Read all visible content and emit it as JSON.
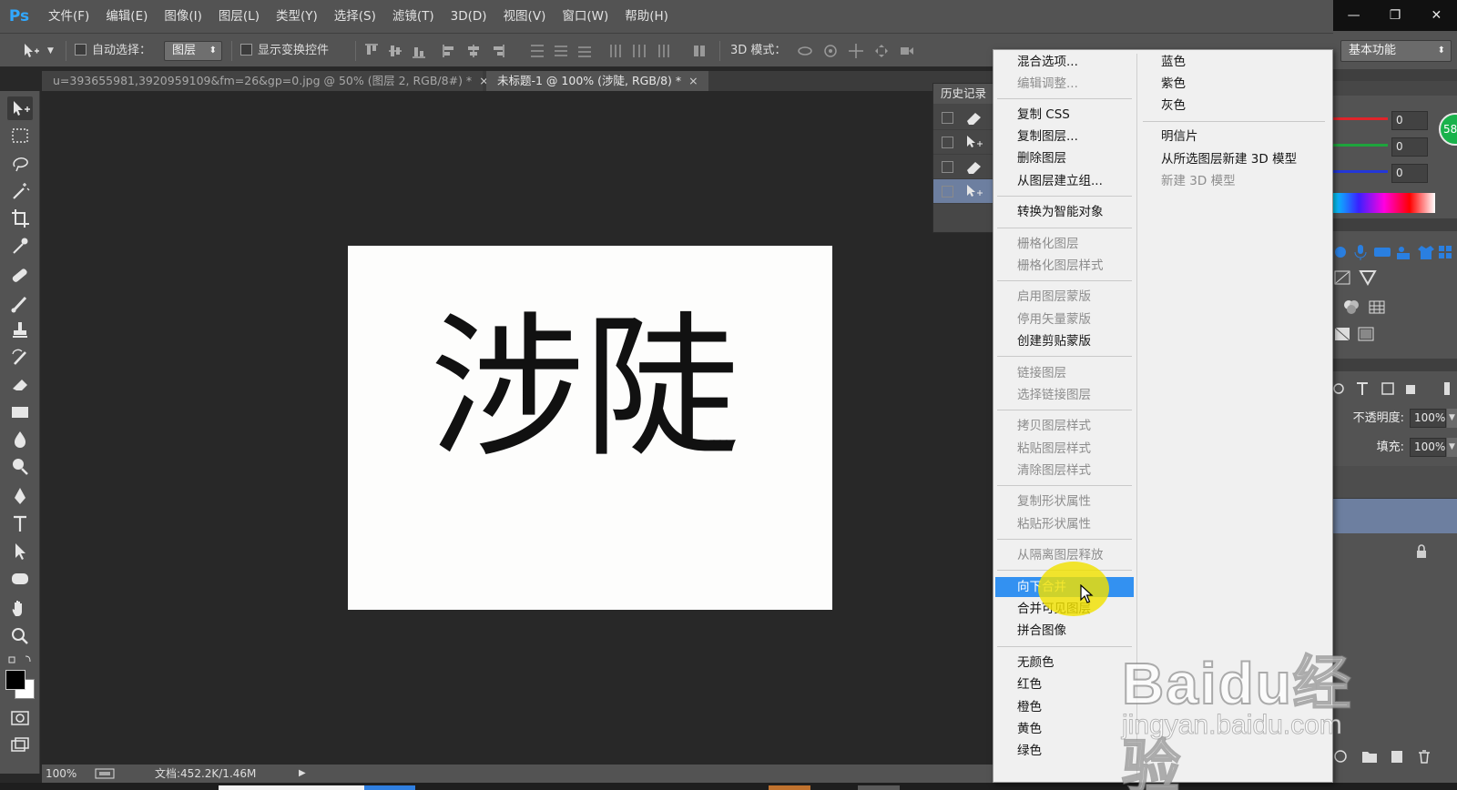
{
  "app": {
    "logo": "Ps",
    "menus": [
      "文件(F)",
      "编辑(E)",
      "图像(I)",
      "图层(L)",
      "类型(Y)",
      "选择(S)",
      "滤镜(T)",
      "3D(D)",
      "视图(V)",
      "窗口(W)",
      "帮助(H)"
    ],
    "window_controls": [
      "—",
      "❐",
      "✕"
    ]
  },
  "options": {
    "auto_select_label": "自动选择：",
    "auto_select_value": "图层",
    "show_transform_label": "显示变换控件",
    "mode_3d_label": "3D 模式："
  },
  "tabs": [
    {
      "label": "u=393655981,3920959109&fm=26&gp=0.jpg @ 50% (图层 2, RGB/8#) *",
      "close": "×"
    },
    {
      "label": "未标题-1 @ 100% (涉陡, RGB/8) *",
      "close": "×"
    }
  ],
  "canvas": {
    "glyph": "涉陡"
  },
  "status": {
    "zoom": "100%",
    "doc_info": "文档:452.2K/1.46M",
    "arrow": "▶"
  },
  "history": {
    "title": "历史记录"
  },
  "context_menu": {
    "col1": [
      {
        "label": "混合选项...",
        "enabled": true
      },
      {
        "label": "编辑调整...",
        "enabled": false
      },
      {
        "label": "复制 CSS",
        "enabled": true
      },
      {
        "label": "复制图层...",
        "enabled": true
      },
      {
        "label": "删除图层",
        "enabled": true
      },
      {
        "label": "从图层建立组...",
        "enabled": true
      },
      {
        "label": "转换为智能对象",
        "enabled": true
      },
      {
        "label": "栅格化图层",
        "enabled": false
      },
      {
        "label": "栅格化图层样式",
        "enabled": false
      },
      {
        "label": "启用图层蒙版",
        "enabled": false
      },
      {
        "label": "停用矢量蒙版",
        "enabled": false
      },
      {
        "label": "创建剪贴蒙版",
        "enabled": true
      },
      {
        "label": "链接图层",
        "enabled": false
      },
      {
        "label": "选择链接图层",
        "enabled": false
      },
      {
        "label": "拷贝图层样式",
        "enabled": false
      },
      {
        "label": "粘贴图层样式",
        "enabled": false
      },
      {
        "label": "清除图层样式",
        "enabled": false
      },
      {
        "label": "复制形状属性",
        "enabled": false
      },
      {
        "label": "粘贴形状属性",
        "enabled": false
      },
      {
        "label": "从隔离图层释放",
        "enabled": false
      },
      {
        "label": "向下合并",
        "enabled": true,
        "highlighted": true
      },
      {
        "label": "合并可见图层",
        "enabled": true
      },
      {
        "label": "拼合图像",
        "enabled": true
      },
      {
        "label": "无颜色",
        "enabled": true
      },
      {
        "label": "红色",
        "enabled": true
      },
      {
        "label": "橙色",
        "enabled": true
      },
      {
        "label": "黄色",
        "enabled": true
      },
      {
        "label": "绿色",
        "enabled": true
      }
    ],
    "col2": [
      {
        "label": "蓝色",
        "enabled": true
      },
      {
        "label": "紫色",
        "enabled": true
      },
      {
        "label": "灰色",
        "enabled": true
      },
      {
        "label": "明信片",
        "enabled": true
      },
      {
        "label": "从所选图层新建 3D 模型",
        "enabled": true
      },
      {
        "label": "新建 3D 模型",
        "enabled": false
      }
    ]
  },
  "right_panel": {
    "workspace": "基本功能",
    "rgb_values": [
      "0",
      "0",
      "0"
    ],
    "circle_text": "58",
    "opacity_label": "不透明度:",
    "opacity_value": "100%",
    "fill_label": "填充:",
    "fill_value": "100%"
  },
  "watermark": {
    "logo": "Baidu经验",
    "url": "jingyan.baidu.com"
  },
  "colors": {
    "menu_highlight": "#3391f1",
    "ui_gray": "#535353",
    "canvas_bg": "#282828",
    "selected_layer": "#6d7fa0",
    "cursor_halo": "#f0e100"
  }
}
